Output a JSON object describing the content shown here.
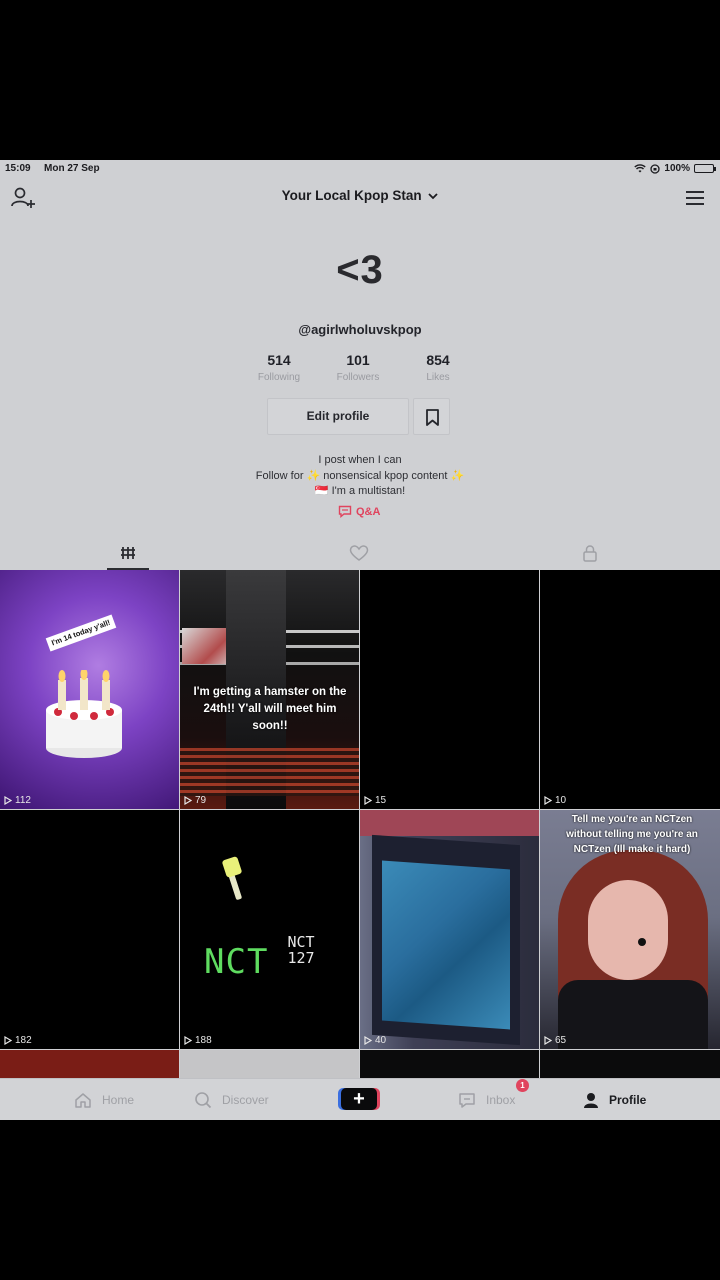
{
  "status_bar": {
    "time": "15:09",
    "date": "Mon 27 Sep",
    "battery": "100%"
  },
  "header": {
    "account_name": "Your Local Kpop Stan"
  },
  "profile": {
    "avatar_text": "<3",
    "handle": "@agirlwholuvskpop",
    "stats": [
      {
        "value": "514",
        "label": "Following"
      },
      {
        "value": "101",
        "label": "Followers"
      },
      {
        "value": "854",
        "label": "Likes"
      }
    ],
    "edit_profile_label": "Edit profile",
    "bio": [
      "I post when I can",
      "Follow for ✨ nonsensical kpop content ✨",
      "🇸🇬 I'm a multistan!"
    ],
    "qa_label": "Q&A"
  },
  "tabs": [
    {
      "name": "videos",
      "icon": "grid-icon",
      "active": true
    },
    {
      "name": "liked",
      "icon": "heart-icon",
      "active": false
    },
    {
      "name": "private",
      "icon": "lock-icon",
      "active": false
    }
  ],
  "videos": [
    {
      "count": "112",
      "overlay": "I'm 14 today y'all!",
      "theme": "purple-cake"
    },
    {
      "count": "79",
      "overlay": "I'm getting a hamster on the 24th!! Y'all will meet him soon!!",
      "theme": "stage"
    },
    {
      "count": "15",
      "overlay": "",
      "theme": "black"
    },
    {
      "count": "10",
      "overlay": "",
      "theme": "black"
    },
    {
      "count": "182",
      "overlay": "",
      "theme": "black"
    },
    {
      "count": "188",
      "overlay": "NCT",
      "overlay2": "NCT 127",
      "theme": "nct"
    },
    {
      "count": "40",
      "overlay": "",
      "theme": "album"
    },
    {
      "count": "65",
      "overlay": "Tell me you're an NCTzen without telling me you're an NCTzen (Ill make it hard)",
      "theme": "selfie"
    }
  ],
  "bottom_nav": {
    "home": "Home",
    "discover": "Discover",
    "create": "+",
    "inbox": "Inbox",
    "inbox_badge": "1",
    "profile": "Profile"
  },
  "colors": {
    "accent": "#e0445e",
    "background": "#cfd0d3"
  }
}
